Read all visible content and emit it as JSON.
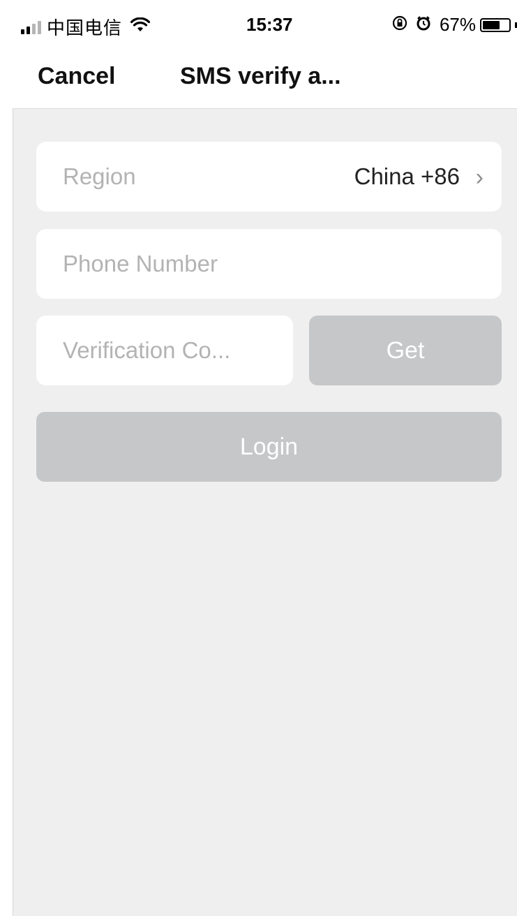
{
  "status_bar": {
    "carrier": "中国电信",
    "time": "15:37",
    "battery_percent": "67%",
    "battery_level": 0.67,
    "icons": [
      "signal-icon",
      "wifi-icon",
      "rotation-lock-icon",
      "alarm-icon",
      "battery-icon"
    ]
  },
  "nav": {
    "cancel_label": "Cancel",
    "title": "SMS verify a..."
  },
  "form": {
    "region": {
      "label": "Region",
      "value": "China +86",
      "chevron": "›"
    },
    "phone": {
      "placeholder": "Phone Number"
    },
    "code": {
      "placeholder": "Verification Co..."
    },
    "get_button": "Get",
    "login_button": "Login"
  },
  "colors": {
    "background": "#efefef",
    "field_bg": "#ffffff",
    "button_disabled": "#c6c7c9",
    "placeholder": "#b3b3b3"
  }
}
